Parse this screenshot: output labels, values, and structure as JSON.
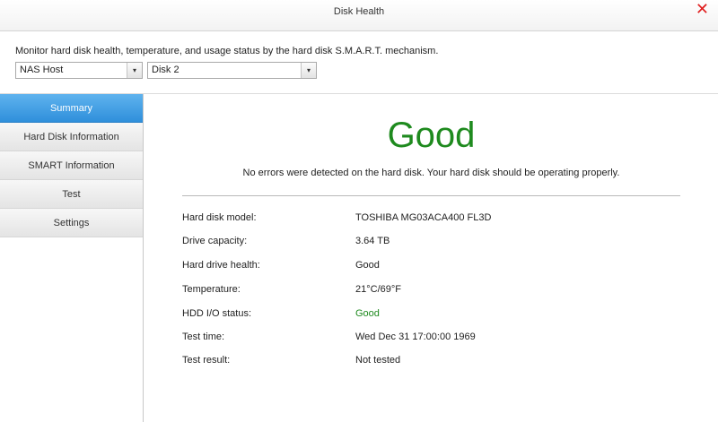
{
  "window": {
    "title": "Disk Health",
    "close_glyph": "✕"
  },
  "description": "Monitor hard disk health, temperature, and usage status by the hard disk S.M.A.R.T. mechanism.",
  "selectors": {
    "host": "NAS Host",
    "disk": "Disk 2",
    "arrow_glyph": "▾"
  },
  "sidebar": {
    "items": [
      {
        "label": "Summary",
        "active": true
      },
      {
        "label": "Hard Disk Information",
        "active": false
      },
      {
        "label": "SMART Information",
        "active": false
      },
      {
        "label": "Test",
        "active": false
      },
      {
        "label": "Settings",
        "active": false
      }
    ]
  },
  "summary": {
    "status": "Good",
    "message": "No errors were detected on the hard disk. Your hard disk should be operating properly.",
    "fields": [
      {
        "label": "Hard disk model:",
        "value": "TOSHIBA MG03ACA400 FL3D"
      },
      {
        "label": "Drive capacity:",
        "value": "3.64 TB"
      },
      {
        "label": "Hard drive health:",
        "value": "Good"
      },
      {
        "label": "Temperature:",
        "value": "21°C/69°F"
      },
      {
        "label": "HDD I/O status:",
        "value": "Good"
      },
      {
        "label": "Test time:",
        "value": "Wed Dec 31 17:00:00 1969"
      },
      {
        "label": "Test result:",
        "value": "Not tested"
      }
    ]
  },
  "colors": {
    "good": "#1e8a1e",
    "active_tab": "#3a97de",
    "close": "#e02020"
  }
}
